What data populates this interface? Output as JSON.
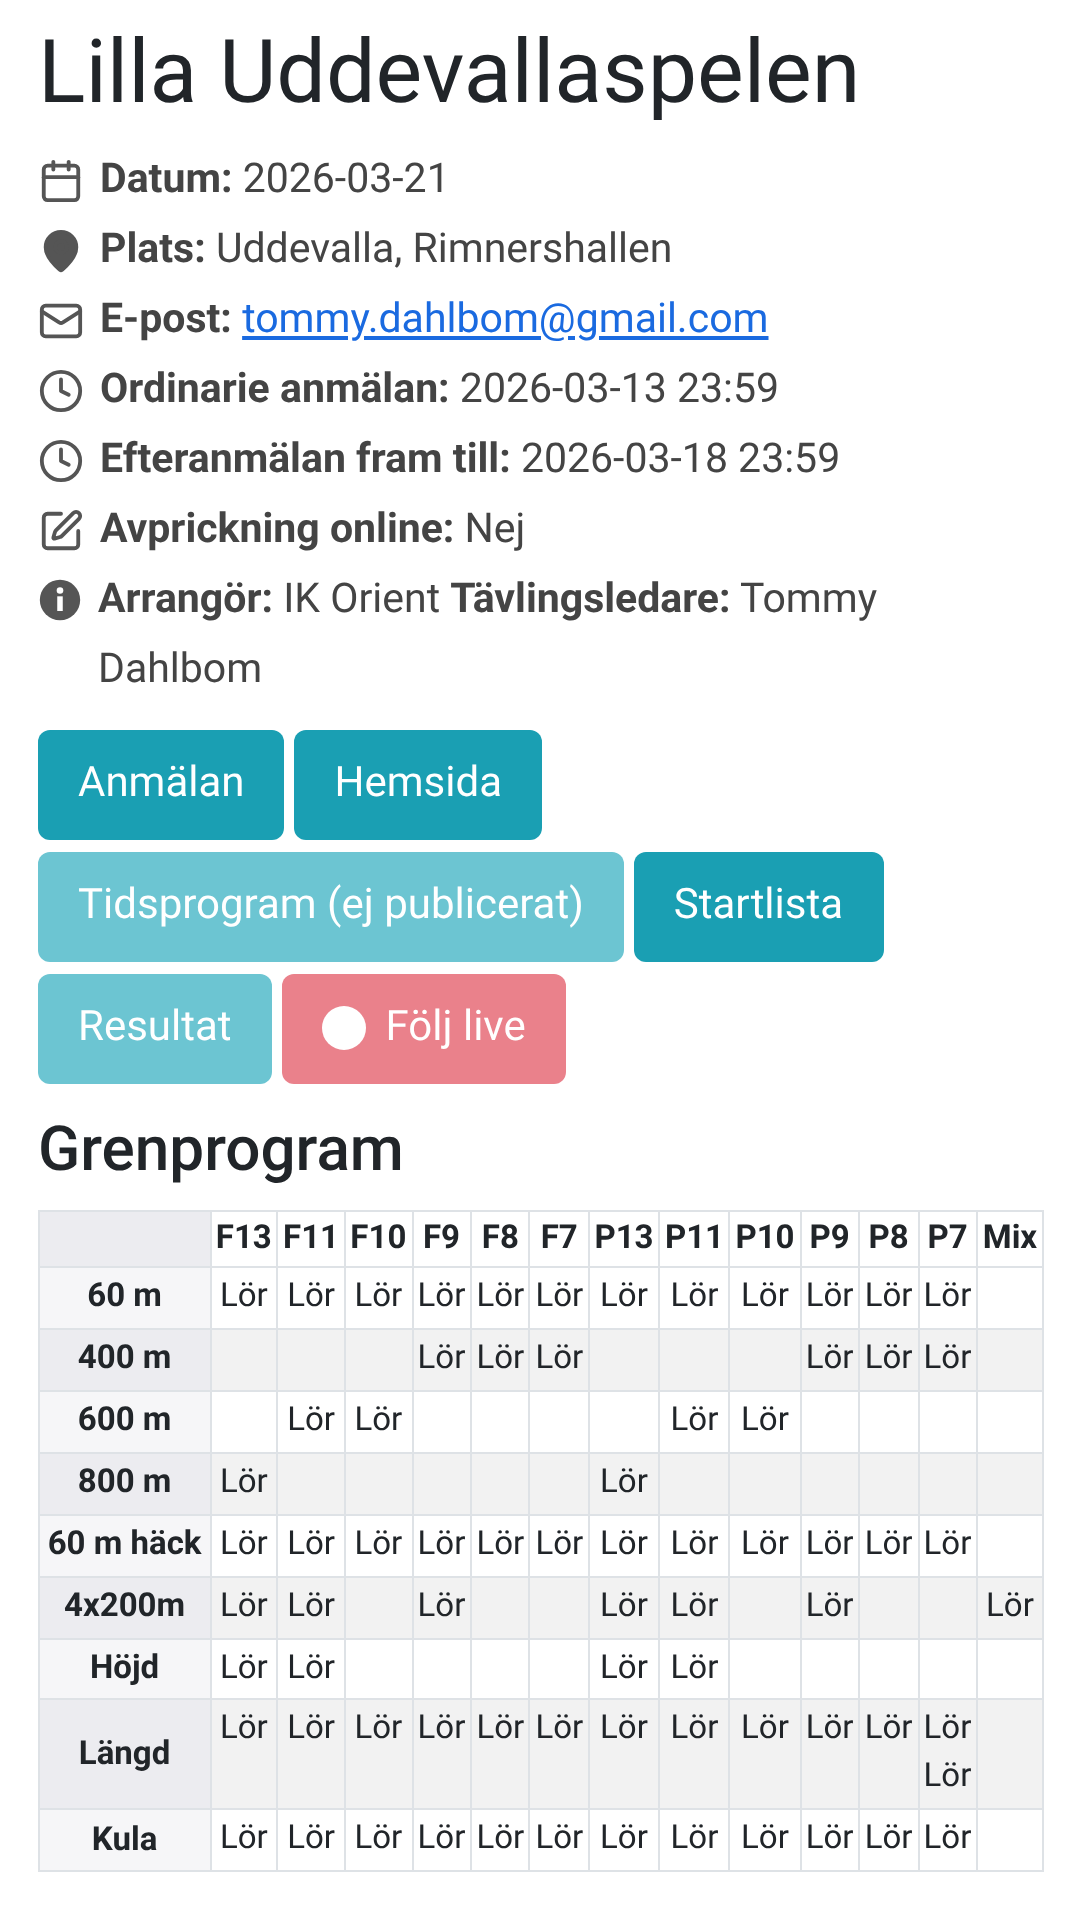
{
  "title": "Lilla Uddevallaspelen",
  "info": [
    {
      "kind": "date",
      "text": "**Datum:** 2026-03-21"
    },
    {
      "kind": "place",
      "text": "**Plats:** Uddevalla, Rimnershallen"
    },
    {
      "kind": "email",
      "text": "**E-post:**",
      "link": "tommy.dahlbom@gmail.com"
    },
    {
      "kind": "deadline",
      "text": "**Ordinarie anmälan:** 2026-03-13 23:59"
    },
    {
      "kind": "deadline",
      "text": "**Efteranmälan fram till:** 2026-03-18 23:59"
    },
    {
      "kind": "checkin",
      "text": "**Avprickning online:** Nej"
    },
    {
      "kind": "organizer",
      "text": "**Arrangör:** IK Orient **Tävlingsledare:** Tommy Dahlbom"
    }
  ],
  "buttons": [
    {
      "label": "Anmälan",
      "kind": "link",
      "disabled": false
    },
    {
      "label": "Hemsida",
      "kind": "link",
      "disabled": false
    },
    {
      "label": "Tidsprogram (ej publicerat)",
      "kind": "link",
      "disabled": true
    },
    {
      "label": "Startlista",
      "kind": "link",
      "disabled": false
    },
    {
      "label": "Resultat",
      "kind": "link",
      "disabled": true
    },
    {
      "label": "Följ live",
      "kind": "live",
      "disabled": true
    }
  ],
  "grenprogram": {
    "heading": "Grenprogram",
    "columns": [
      "F13",
      "F11",
      "F10",
      "F9",
      "F8",
      "F7",
      "P13",
      "P11",
      "P10",
      "P9",
      "P8",
      "P7",
      "Mix"
    ],
    "rows": [
      {
        "event": "60 m",
        "cells": [
          "Lör",
          "Lör",
          "Lör",
          "Lör",
          "Lör",
          "Lör",
          "Lör",
          "Lör",
          "Lör",
          "Lör",
          "Lör",
          "Lör",
          null
        ]
      },
      {
        "event": "400 m",
        "cells": [
          null,
          null,
          null,
          "Lör",
          "Lör",
          "Lör",
          null,
          null,
          null,
          "Lör",
          "Lör",
          "Lör",
          null
        ]
      },
      {
        "event": "600 m",
        "cells": [
          null,
          "Lör",
          "Lör",
          null,
          null,
          null,
          null,
          "Lör",
          "Lör",
          null,
          null,
          null,
          null
        ]
      },
      {
        "event": "800 m",
        "cells": [
          "Lör",
          null,
          null,
          null,
          null,
          null,
          "Lör",
          null,
          null,
          null,
          null,
          null,
          null
        ]
      },
      {
        "event": "60 m häck",
        "cells": [
          "Lör",
          "Lör",
          "Lör",
          "Lör",
          "Lör",
          "Lör",
          "Lör",
          "Lör",
          "Lör",
          "Lör",
          "Lör",
          "Lör",
          null
        ]
      },
      {
        "event": "4x200m",
        "cells": [
          "Lör",
          "Lör",
          null,
          "Lör",
          null,
          null,
          "Lör",
          "Lör",
          null,
          "Lör",
          null,
          null,
          "Lör"
        ]
      },
      {
        "event": "Höjd",
        "cells": [
          "Lör",
          "Lör",
          null,
          null,
          null,
          null,
          "Lör",
          "Lör",
          null,
          null,
          null,
          null,
          null
        ]
      },
      {
        "event": "Längd",
        "cells": [
          "Lör",
          "Lör",
          "Lör",
          "Lör",
          "Lör",
          "Lör",
          "Lör",
          "Lör",
          "Lör",
          "Lör",
          "Lör",
          "Lör\nLör",
          null
        ]
      },
      {
        "event": "Kula",
        "cells": [
          "Lör",
          "Lör",
          "Lör",
          "Lör",
          "Lör",
          "Lör",
          "Lör",
          "Lör",
          "Lör",
          "Lör",
          "Lör",
          "Lör",
          null
        ]
      }
    ]
  }
}
